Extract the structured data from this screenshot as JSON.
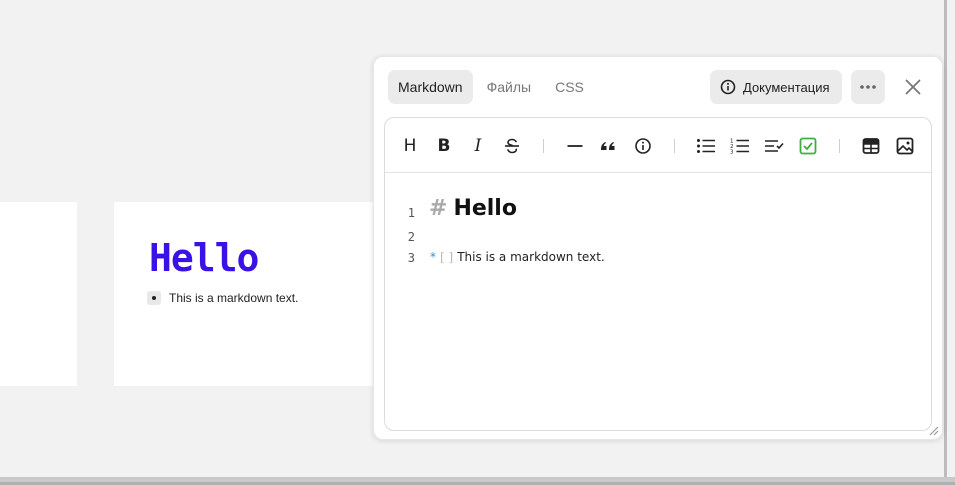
{
  "preview": {
    "title": "Hello",
    "item_text": "This is a markdown text."
  },
  "panel": {
    "tabs": [
      {
        "label": "Markdown",
        "active": true
      },
      {
        "label": "Файлы",
        "active": false
      },
      {
        "label": "CSS",
        "active": false
      }
    ],
    "doc_button_label": "Документация",
    "more_icon": "more-horizontal-icon",
    "close_icon": "close-icon"
  },
  "toolbar": {
    "heading_label": "H",
    "bold_label": "B",
    "italic_label": "I",
    "overflow_label": "···",
    "icons": [
      "heading-icon",
      "bold-icon",
      "italic-icon",
      "strikethrough-icon",
      "horizontal-rule-icon",
      "quote-icon",
      "info-icon",
      "bullet-list-icon",
      "numbered-list-icon",
      "task-list-icon",
      "checkbox-checked-icon",
      "table-icon",
      "image-icon",
      "more-icon"
    ],
    "accent_color": "#3fae3f"
  },
  "editor": {
    "lines": [
      {
        "number": "1",
        "marker": "#",
        "text": "Hello"
      },
      {
        "number": "2",
        "text": ""
      },
      {
        "number": "3",
        "marker": "*",
        "checkbox": "[ ]",
        "text": "This is a markdown text."
      }
    ]
  },
  "colors": {
    "preview_title": "#3a12e6",
    "background": "#f2f2f2"
  }
}
